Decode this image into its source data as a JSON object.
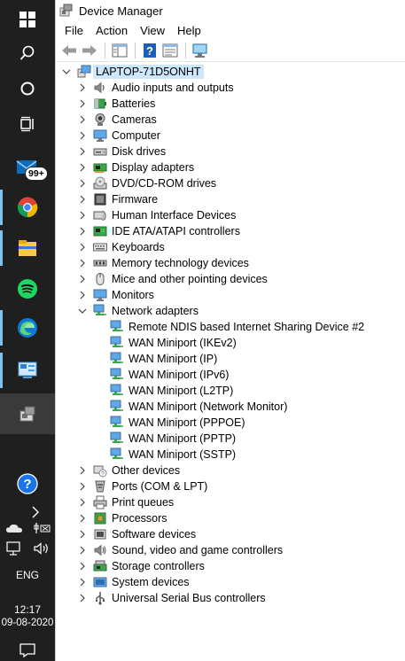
{
  "taskbar": {
    "mail_badge": "99+",
    "language": "ENG",
    "time": "12:17",
    "date": "09-08-2020"
  },
  "window": {
    "title": "Device Manager",
    "menu": [
      "File",
      "Action",
      "View",
      "Help"
    ]
  },
  "tree": {
    "root": "LAPTOP-71D5ONHT",
    "categories": [
      {
        "label": "Audio inputs and outputs",
        "icon": "speaker-icon"
      },
      {
        "label": "Batteries",
        "icon": "battery-icon"
      },
      {
        "label": "Cameras",
        "icon": "camera-icon"
      },
      {
        "label": "Computer",
        "icon": "computer-icon"
      },
      {
        "label": "Disk drives",
        "icon": "disk-drive-icon"
      },
      {
        "label": "Display adapters",
        "icon": "display-adapter-icon"
      },
      {
        "label": "DVD/CD-ROM drives",
        "icon": "dvd-icon"
      },
      {
        "label": "Firmware",
        "icon": "firmware-icon"
      },
      {
        "label": "Human Interface Devices",
        "icon": "hid-icon"
      },
      {
        "label": "IDE ATA/ATAPI controllers",
        "icon": "ide-icon"
      },
      {
        "label": "Keyboards",
        "icon": "keyboard-icon"
      },
      {
        "label": "Memory technology devices",
        "icon": "memory-icon"
      },
      {
        "label": "Mice and other pointing devices",
        "icon": "mouse-icon"
      },
      {
        "label": "Monitors",
        "icon": "monitor-icon"
      },
      {
        "label": "Network adapters",
        "icon": "network-adapter-icon",
        "expanded": true
      }
    ],
    "network_adapters": [
      "Remote NDIS based Internet Sharing Device #2",
      "WAN Miniport (IKEv2)",
      "WAN Miniport (IP)",
      "WAN Miniport (IPv6)",
      "WAN Miniport (L2TP)",
      "WAN Miniport (Network Monitor)",
      "WAN Miniport (PPPOE)",
      "WAN Miniport (PPTP)",
      "WAN Miniport (SSTP)"
    ],
    "categories_after": [
      {
        "label": "Other devices",
        "icon": "other-devices-icon"
      },
      {
        "label": "Ports (COM & LPT)",
        "icon": "port-icon"
      },
      {
        "label": "Print queues",
        "icon": "printer-icon"
      },
      {
        "label": "Processors",
        "icon": "processor-icon"
      },
      {
        "label": "Software devices",
        "icon": "software-device-icon"
      },
      {
        "label": "Sound, video and game controllers",
        "icon": "sound-icon"
      },
      {
        "label": "Storage controllers",
        "icon": "storage-icon"
      },
      {
        "label": "System devices",
        "icon": "system-device-icon"
      },
      {
        "label": "Universal Serial Bus controllers",
        "icon": "usb-icon"
      }
    ]
  }
}
